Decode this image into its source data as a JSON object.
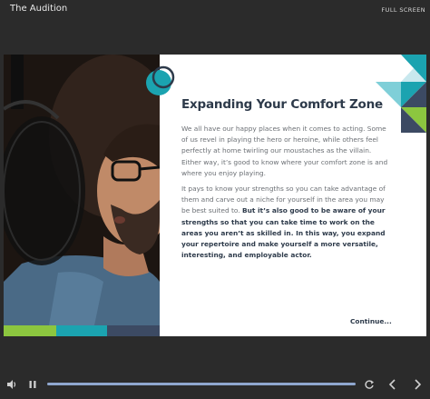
{
  "window": {
    "title": "The Audition",
    "fullscreen_label": "FULL SCREEN"
  },
  "slide": {
    "heading": "Expanding Your Comfort Zone",
    "paragraph1": "We all have our happy places when it comes to acting. Some of us revel in playing the hero or heroine, while others feel perfectly at home twirling our moustaches as the villain. Either way, it’s good to know where your comfort zone is and where you enjoy playing.",
    "paragraph2_plain": "It pays to know your strengths so you can take advantage of them and carve out a niche for yourself in the area you may be best suited to. ",
    "paragraph2_bold": "But it’s also good to be aware of your strengths so that you can take time to work on the areas you aren’t as skilled in. In this way, you expand your repertoire and make yourself a more versatile, interesting, and employable actor.",
    "continue_label": "Continue...",
    "strip_colors": [
      "#8cc63f",
      "#1ba3b0",
      "#3c4a63"
    ],
    "accent_teal": "#1ba3b0",
    "accent_green": "#8cc63f",
    "accent_navy": "#2d3a4a"
  },
  "player": {
    "progress": 1.0,
    "icons": [
      "volume-icon",
      "pause-icon",
      "replay-icon",
      "previous-icon",
      "next-icon"
    ]
  }
}
